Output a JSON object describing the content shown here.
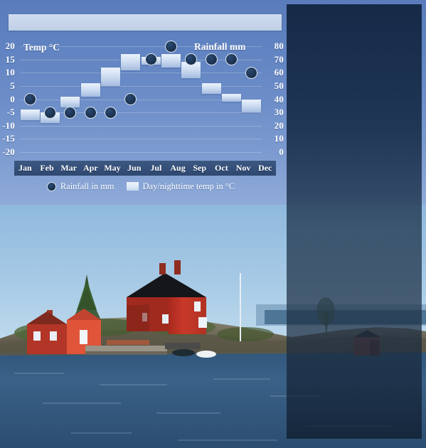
{
  "title_bar": {
    "text": ""
  },
  "chart_data": {
    "type": "bar",
    "title": "",
    "categories": [
      "Jan",
      "Feb",
      "Mar",
      "Apr",
      "May",
      "Jun",
      "Jul",
      "Aug",
      "Sep",
      "Oct",
      "Nov",
      "Dec"
    ],
    "xlabel": "",
    "left_axis": {
      "label": "Temp °C",
      "ticks": [
        "20",
        "15",
        "10",
        "5",
        "0",
        "-5",
        "-10",
        "-15",
        "-20"
      ],
      "values": [
        20,
        15,
        10,
        5,
        0,
        -5,
        -10,
        -15,
        -20
      ],
      "ylim": [
        -20,
        20
      ],
      "unit": "°C"
    },
    "right_axis": {
      "label": "Rainfall mm",
      "ticks": [
        "80",
        "70",
        "60",
        "50",
        "40",
        "30",
        "20",
        "10",
        "0"
      ],
      "values": [
        80,
        70,
        60,
        50,
        40,
        30,
        20,
        10,
        0
      ],
      "ylim": [
        0,
        80
      ],
      "unit": "mm"
    },
    "grid": true,
    "legend_position": "bottom",
    "series": [
      {
        "name": "Day/nighttime temp in °C",
        "type": "range-bar",
        "axis": "left",
        "high": [
          -4,
          -5,
          1,
          6,
          12,
          17,
          16,
          17,
          14,
          6,
          2,
          0
        ],
        "low": [
          -8,
          -9,
          -3,
          1,
          5,
          11,
          13,
          12,
          8,
          2,
          -1,
          -5
        ]
      },
      {
        "name": "Rainfall in mm",
        "type": "scatter",
        "axis": "right",
        "values": [
          40,
          30,
          30,
          30,
          30,
          40,
          70,
          80,
          70,
          70,
          70,
          60
        ]
      }
    ],
    "legend": [
      {
        "label": "Rainfall in mm",
        "marker": "dot",
        "color": "#1d3554"
      },
      {
        "label": "Day/nighttime temp in °C",
        "marker": "swatch",
        "color": "#dce8f7"
      }
    ]
  },
  "photo": {
    "alt": "Red wooden houses on a rocky archipelago island by the sea",
    "sky_color": "#9ec6e4",
    "water_color": "#3a5f86",
    "house_color": "#c0392b",
    "rock_color": "#6e6a5c"
  },
  "overlay_panel": {
    "color": "#16243e"
  }
}
